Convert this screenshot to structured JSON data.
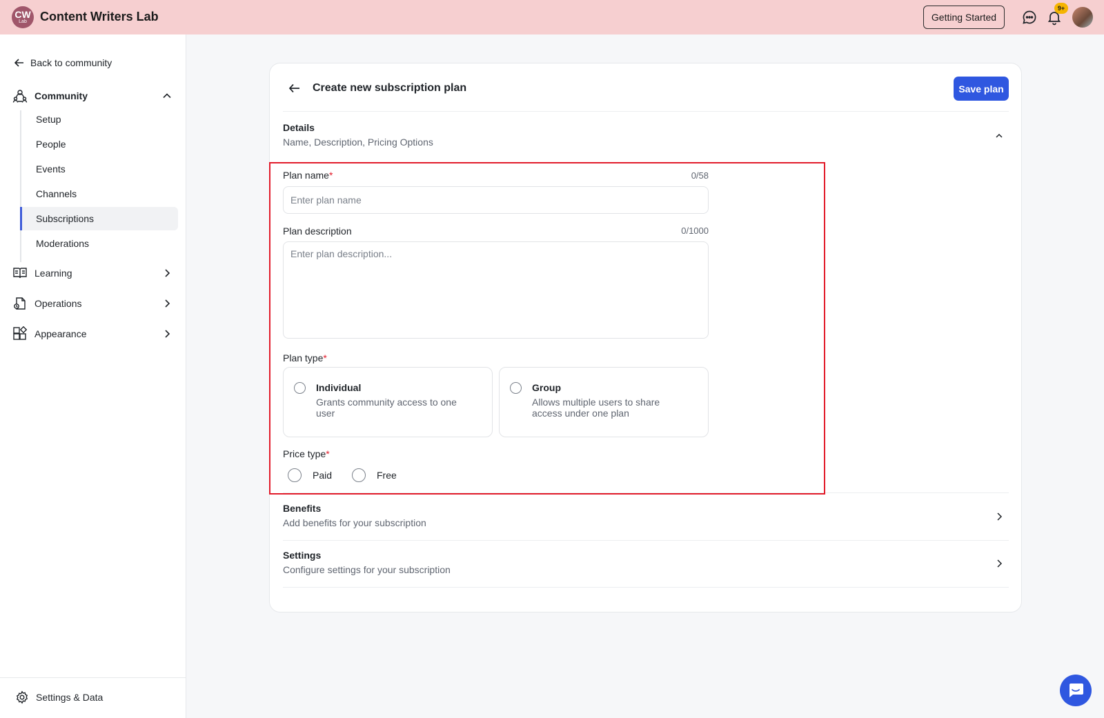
{
  "app": {
    "logo_text": "CW",
    "logo_subtext": "Lab",
    "title": "Content Writers Lab"
  },
  "topbar": {
    "getting_started_label": "Getting Started",
    "notification_badge": "9+"
  },
  "sidebar": {
    "back_label": "Back to community",
    "community": {
      "label": "Community",
      "items": [
        {
          "label": "Setup"
        },
        {
          "label": "People"
        },
        {
          "label": "Events"
        },
        {
          "label": "Channels"
        },
        {
          "label": "Subscriptions",
          "active": true
        },
        {
          "label": "Moderations"
        }
      ]
    },
    "groups": [
      {
        "label": "Learning",
        "icon": "book-icon"
      },
      {
        "label": "Operations",
        "icon": "operations-icon"
      },
      {
        "label": "Appearance",
        "icon": "widgets-icon"
      }
    ],
    "footer_label": "Settings & Data"
  },
  "page": {
    "title": "Create new subscription plan",
    "save_label": "Save plan",
    "details": {
      "title": "Details",
      "subtitle": "Name, Description, Pricing Options"
    },
    "form": {
      "plan_name": {
        "label": "Plan name",
        "required": "*",
        "count": "0/58",
        "placeholder": "Enter plan name",
        "value": ""
      },
      "plan_description": {
        "label": "Plan description",
        "count": "0/1000",
        "placeholder": "Enter plan description...",
        "value": ""
      },
      "plan_type": {
        "label": "Plan type",
        "required": "*",
        "options": [
          {
            "title": "Individual",
            "description": "Grants community access to one user",
            "selected": false
          },
          {
            "title": "Group",
            "description": "Allows multiple users to share access under one plan",
            "selected": false
          }
        ]
      },
      "price_type": {
        "label": "Price type",
        "required": "*",
        "options": [
          {
            "label": "Paid",
            "selected": false
          },
          {
            "label": "Free",
            "selected": false
          }
        ]
      }
    },
    "benefits": {
      "title": "Benefits",
      "subtitle": "Add benefits for your subscription"
    },
    "settings": {
      "title": "Settings",
      "subtitle": "Configure settings for your subscription"
    }
  },
  "colors": {
    "topbar_bg": "#f6cfd0",
    "accent": "#2f57e0",
    "highlight_border": "#e21b2a",
    "required": "#e21b2a",
    "badge": "#f5b400"
  }
}
